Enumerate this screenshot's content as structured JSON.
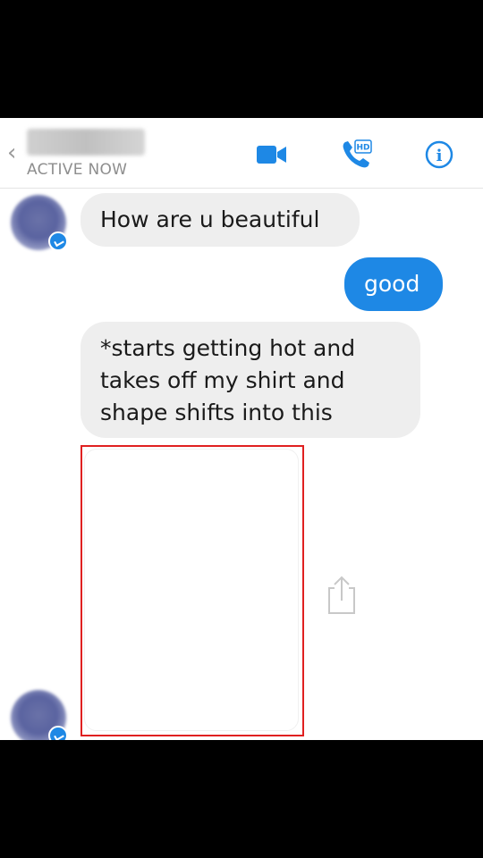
{
  "header": {
    "back_icon": "‹",
    "status": "ACTIVE NOW",
    "icons": [
      "chevron-left-icon",
      "video-camera-icon",
      "phone-hd-icon",
      "info-icon"
    ],
    "hd_label": "HD",
    "info_glyph": "i",
    "accent_color": "#1e88e5"
  },
  "messages": [
    {
      "direction": "incoming",
      "text": "How are u beautiful"
    },
    {
      "direction": "outgoing",
      "text": "good"
    },
    {
      "direction": "incoming",
      "text": "*starts getting hot and takes off my shirt and shape shifts into this"
    }
  ],
  "colors": {
    "incoming_bubble": "#eeeeee",
    "outgoing_bubble": "#1e88e5",
    "highlight_border": "#e02020"
  }
}
